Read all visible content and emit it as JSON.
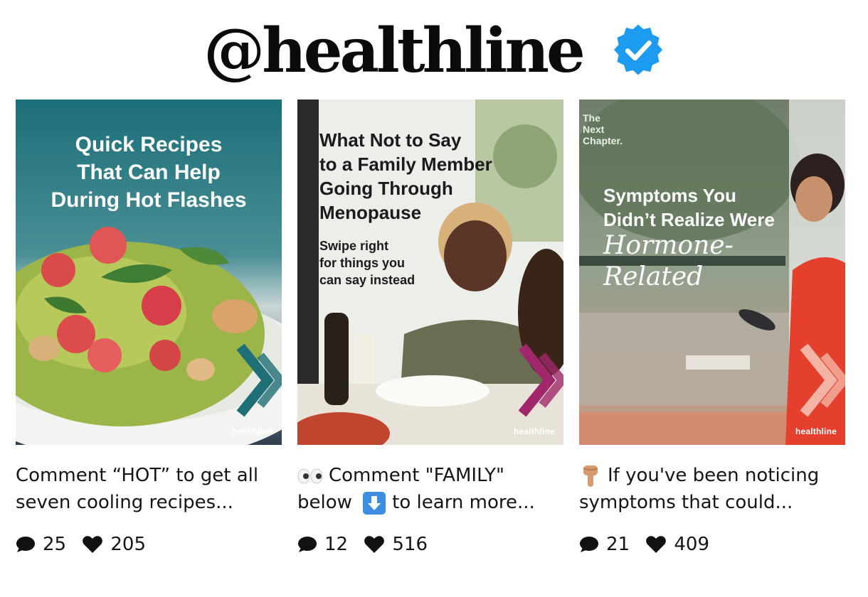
{
  "header": {
    "handle": "@healthline"
  },
  "posts": [
    {
      "title_lines": [
        "Quick Recipes",
        "That Can Help",
        "During Hot Flashes"
      ],
      "brand": "healthline",
      "caption_lines": [
        "Comment “HOT” to get all",
        "seven cooling recipes..."
      ],
      "comments": "25",
      "likes": "205"
    },
    {
      "title_lines": [
        "What Not to Say",
        "to a Family Member",
        "Going Through",
        "Menopause"
      ],
      "sub_lines": [
        "Swipe right",
        "for things you",
        "can say instead"
      ],
      "brand": "healthline",
      "caption_lines": [
        "Comment \"FAMILY\"",
        "below",
        "to learn more..."
      ],
      "comments": "12",
      "likes": "516"
    },
    {
      "corner_lines": [
        "The",
        "Next",
        "Chapter."
      ],
      "title_lines": [
        "Symptoms You",
        "Didn’t Realize Were"
      ],
      "script_lines": [
        "Hormone-",
        "Related"
      ],
      "brand": "healthline",
      "caption_lines": [
        "If you've been noticing",
        "symptoms that could..."
      ],
      "comments": "21",
      "likes": "409"
    }
  ],
  "colors": {
    "verified": "#1d9bf0",
    "teal": "#1f6f77",
    "magenta": "#a0286a",
    "coral": "#e8533f"
  },
  "icons": [
    "verified-badge-icon",
    "chevron-right-icon",
    "eyes-icon",
    "down-arrow-icon",
    "pointing-down-icon",
    "comment-icon",
    "heart-icon"
  ]
}
